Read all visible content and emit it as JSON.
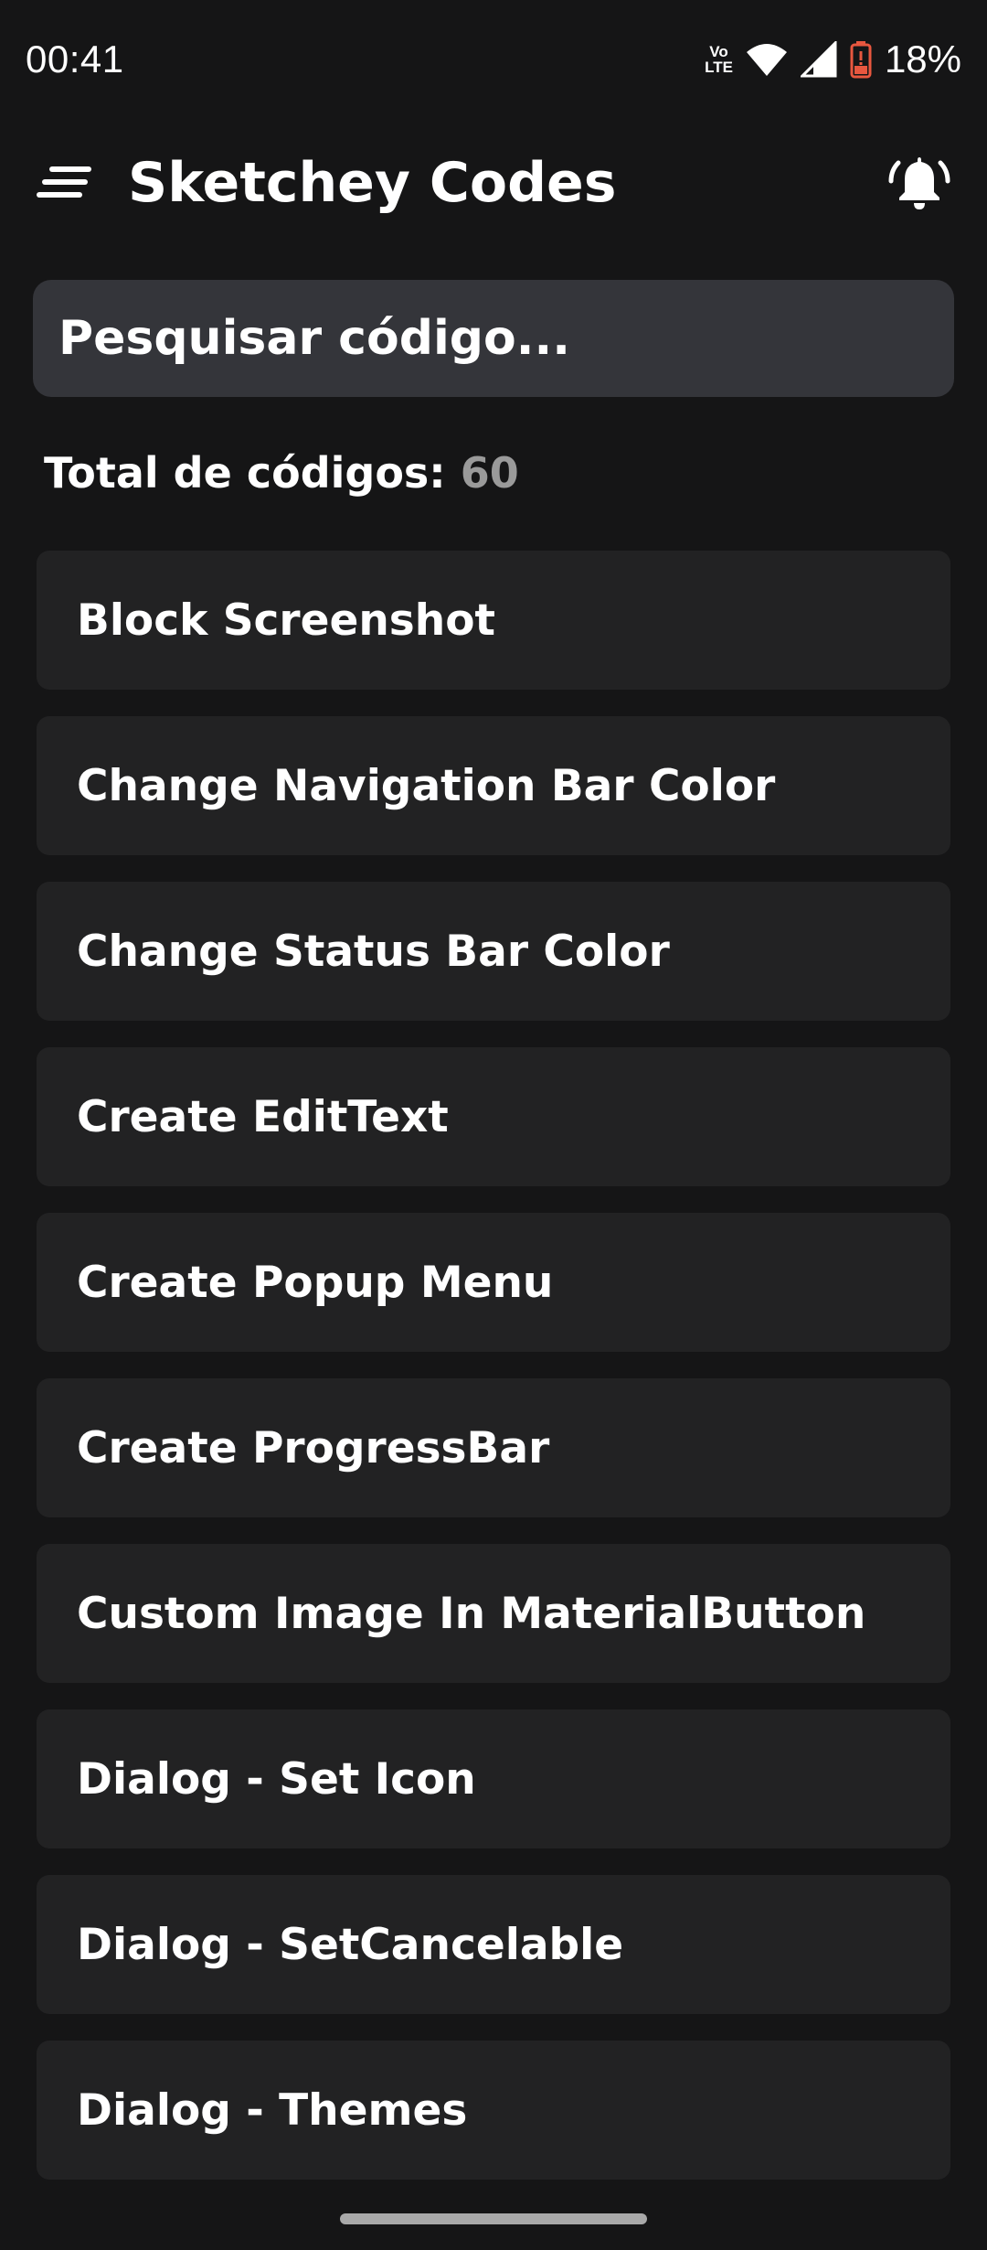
{
  "status_bar": {
    "time": "00:41",
    "volte_top": "Vo",
    "volte_bottom": "LTE",
    "battery_percent": "18%"
  },
  "app_bar": {
    "title": "Sketchey Codes",
    "menu_icon": "menu-icon",
    "bell_icon": "bell-ring-icon"
  },
  "search": {
    "placeholder": "Pesquisar código..."
  },
  "total": {
    "label": "Total de códigos:",
    "count": "60"
  },
  "list": {
    "items": [
      "Block Screenshot",
      "Change Navigation Bar Color",
      "Change Status Bar Color",
      "Create EditText",
      "Create Popup Menu",
      "Create ProgressBar",
      "Custom Image In MaterialButton",
      "Dialog - Set Icon",
      "Dialog - SetCancelable",
      "Dialog - Themes"
    ]
  },
  "colors": {
    "background": "#151516",
    "search_bg": "#34353a",
    "card_bg": "#222223",
    "count_text": "#9a9a9a",
    "battery_accent": "#e8573f"
  }
}
